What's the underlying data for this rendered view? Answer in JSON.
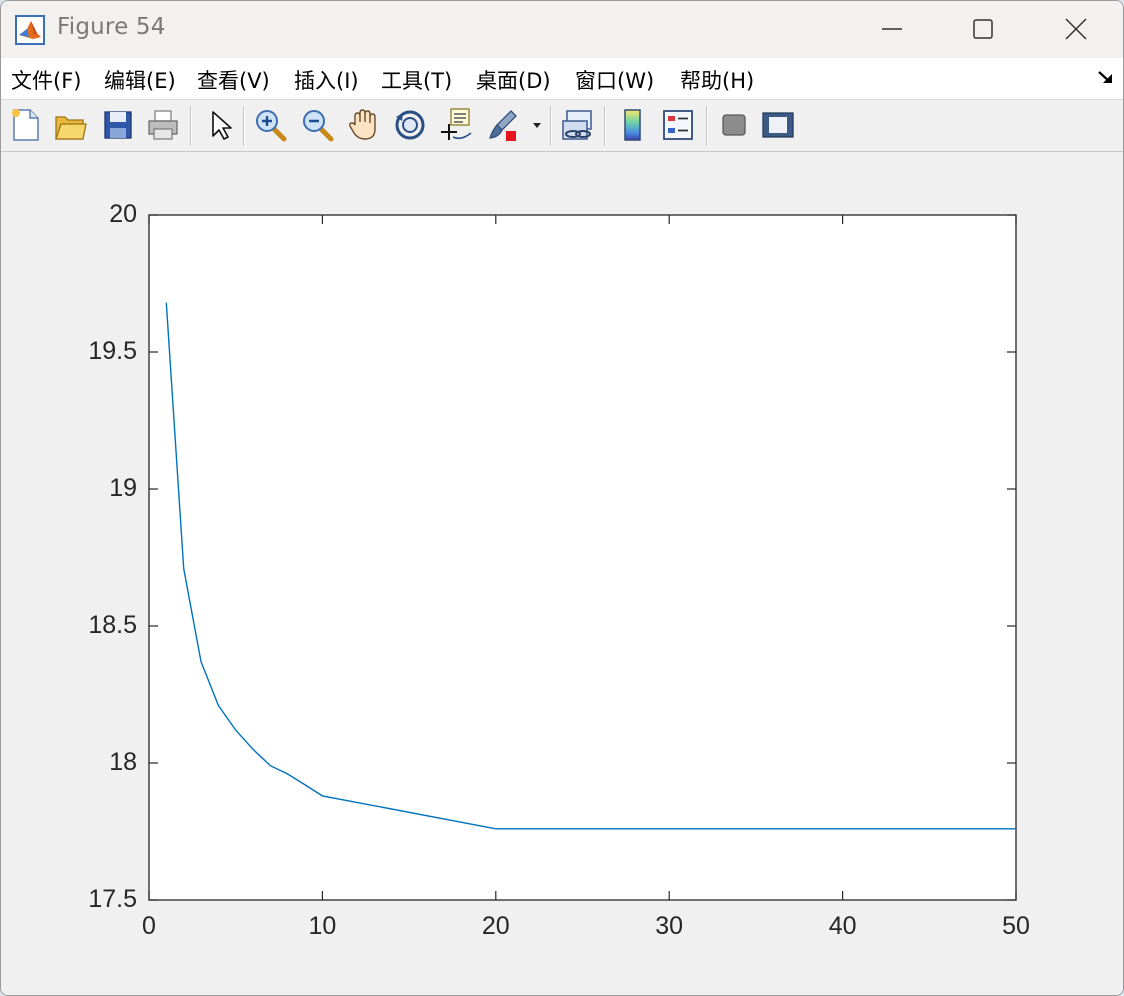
{
  "window": {
    "title": "Figure 54"
  },
  "menu": {
    "items": [
      "文件(F)",
      "编辑(E)",
      "查看(V)",
      "插入(I)",
      "工具(T)",
      "桌面(D)",
      "窗口(W)",
      "帮助(H)"
    ]
  },
  "toolbar": {
    "buttons": [
      {
        "name": "new-figure-icon"
      },
      {
        "name": "open-file-icon"
      },
      {
        "name": "save-icon"
      },
      {
        "name": "print-icon"
      },
      {
        "name": "pointer-icon"
      },
      {
        "name": "zoom-in-icon"
      },
      {
        "name": "zoom-out-icon"
      },
      {
        "name": "pan-hand-icon"
      },
      {
        "name": "rotate-3d-icon"
      },
      {
        "name": "data-cursor-icon"
      },
      {
        "name": "brush-icon"
      },
      {
        "name": "link-plot-icon"
      },
      {
        "name": "colorbar-icon"
      },
      {
        "name": "legend-icon"
      },
      {
        "name": "hide-plot-tools-icon"
      },
      {
        "name": "show-plot-tools-icon"
      }
    ]
  },
  "colors": {
    "line": "#0072bd",
    "axes_background": "#ffffff",
    "figure_background": "#f0f0f0"
  },
  "chart_data": {
    "type": "line",
    "title": "",
    "xlabel": "",
    "ylabel": "",
    "xlim": [
      0,
      50
    ],
    "ylim": [
      17.5,
      20
    ],
    "xticks": [
      "0",
      "10",
      "20",
      "30",
      "40",
      "50"
    ],
    "yticks": [
      "17.5",
      "18",
      "18.5",
      "19",
      "19.5",
      "20"
    ],
    "grid": false,
    "series": [
      {
        "x": [
          1,
          2,
          3,
          4,
          5,
          6,
          7,
          8,
          9,
          10,
          20,
          30,
          40,
          50
        ],
        "y": [
          19.68,
          18.71,
          18.37,
          18.21,
          18.12,
          18.05,
          17.99,
          17.96,
          17.92,
          17.88,
          17.76,
          17.76,
          17.76,
          17.76
        ]
      }
    ]
  }
}
